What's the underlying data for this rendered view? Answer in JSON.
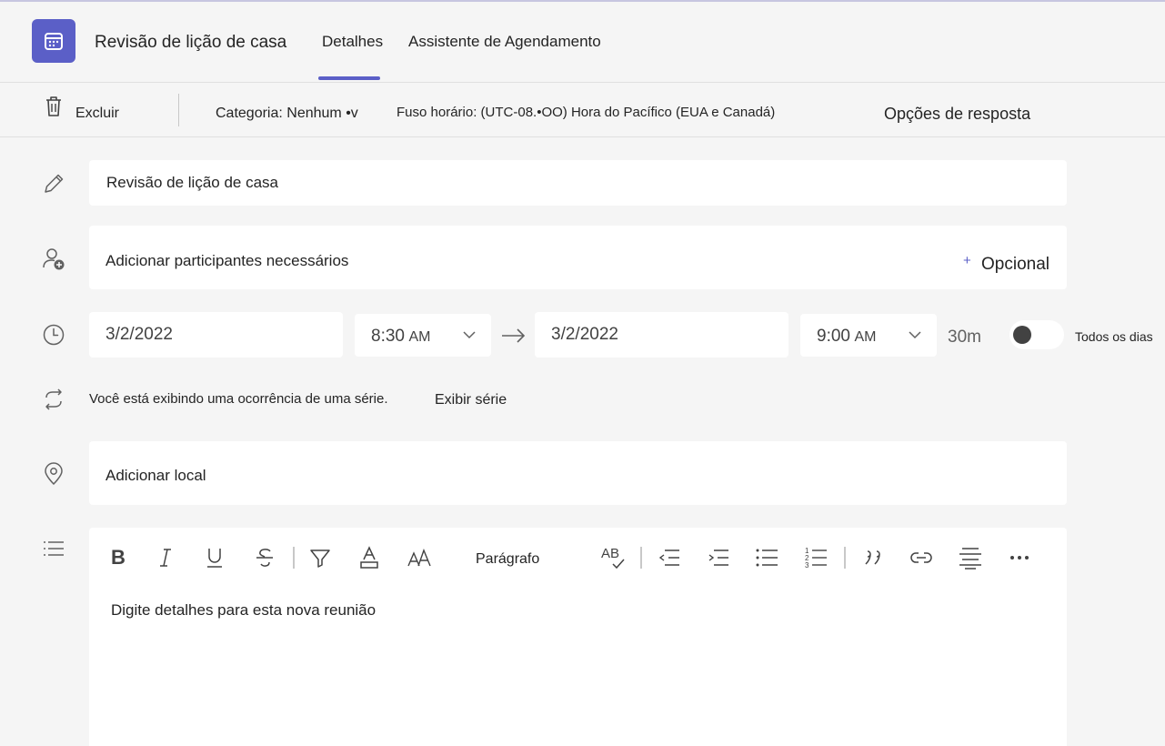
{
  "header": {
    "title": "Revisão de lição de casa",
    "tabs": [
      {
        "label": "Detalhes",
        "selected": true
      },
      {
        "label": "Assistente de Agendamento",
        "selected": false
      }
    ],
    "accent_color": "#5b5fc7"
  },
  "toolbar": {
    "delete_label": "Excluir",
    "category_label": "Categoria: Nenhum •v",
    "timezone_label": "Fuso horário: (UTC-08.•OO) Hora do Pacífico (EUA e Canadá)",
    "response_options_label": "Opções de resposta"
  },
  "form": {
    "title_value": "Revisão de lição de casa",
    "attendees_placeholder": "Adicionar participantes necessários",
    "optional_plus": "+",
    "optional_label": "Opcional",
    "start_date": "3/2/2022",
    "start_time": "8:30",
    "start_ampm": "AM",
    "end_date": "3/2/2022",
    "end_time": "9:00",
    "end_ampm": "AM",
    "duration": "30m",
    "all_day_label": "Todos os dias",
    "all_day_on": false,
    "recurrence_text": "Você está exibindo uma ocorrência de uma série.",
    "view_series_label": "Exibir série",
    "location_placeholder": "Adicionar local",
    "editor": {
      "paragraph_label": "Parágrafo",
      "spellcheck_label": "AB",
      "details_placeholder": "Digite detalhes para esta nova reunião"
    }
  }
}
